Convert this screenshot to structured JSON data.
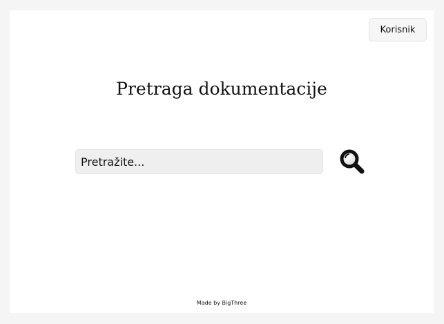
{
  "header": {
    "user_button_label": "Korisnik"
  },
  "main": {
    "title": "Pretraga dokumentacije",
    "search": {
      "placeholder": "Pretražite...",
      "value": "",
      "button_icon": "magnifying-glass-icon"
    }
  },
  "footer": {
    "text": "Made by BigThree"
  },
  "colors": {
    "page_background": "#f5f5f5",
    "card_background": "#ffffff",
    "input_background": "#efefef",
    "icon": "#111111"
  }
}
